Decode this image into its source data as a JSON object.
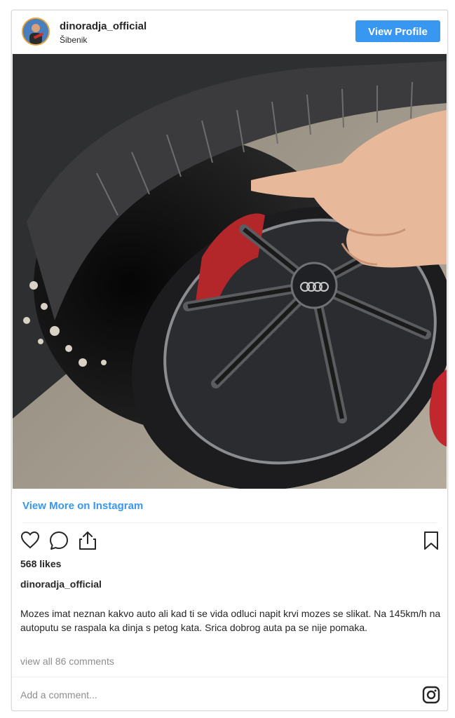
{
  "post": {
    "username": "dinoradja_official",
    "location": "Šibenik",
    "view_profile_label": "View Profile",
    "view_more_label": "View More on Instagram",
    "likes": "568 likes",
    "caption_username": "dinoradja_official",
    "caption": "Mozes imat neznan kakvo auto ali kad ti se vida odluci napit krvi mozes se slikat. Na 145km/h na autoputu se raspala ka dinja s petog kata. Srica dobrog auta pa se nije pomaka.",
    "view_comments": "view all 86 comments",
    "add_comment_placeholder": "Add a comment..."
  },
  "icons": [
    "heart-icon",
    "comment-icon",
    "share-icon",
    "bookmark-icon",
    "instagram-icon"
  ],
  "colors": {
    "accent": "#3897f0",
    "text": "#262626",
    "muted": "#8e8e8e"
  }
}
